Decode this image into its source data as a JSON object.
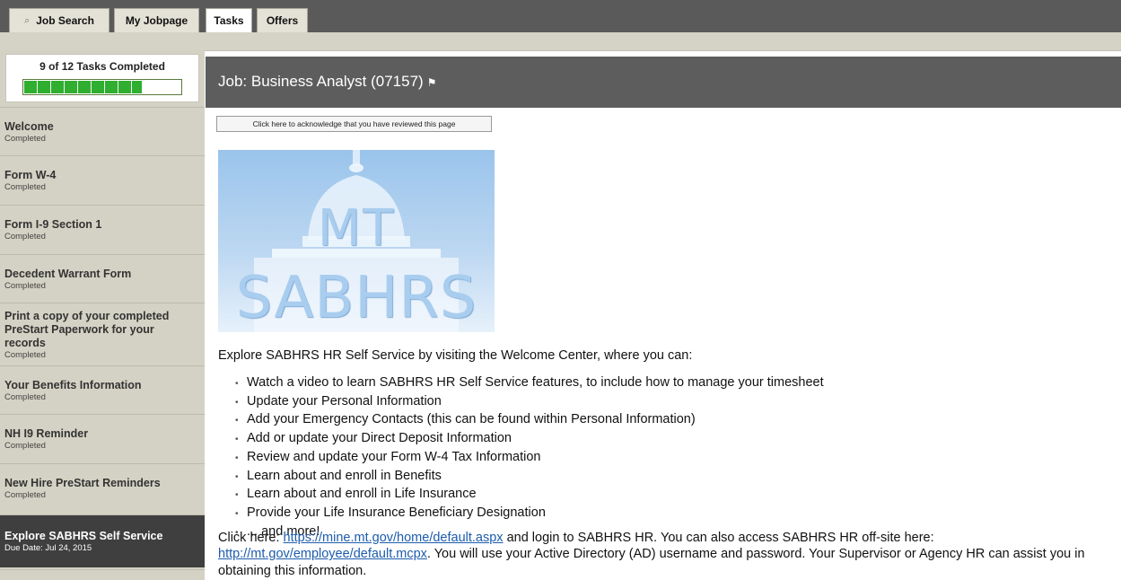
{
  "tabs": [
    {
      "label": "Job Search",
      "icon": "search-icon"
    },
    {
      "label": "My Jobpage"
    },
    {
      "label": "Tasks",
      "active": true
    },
    {
      "label": "Offers"
    }
  ],
  "progress": {
    "label": "9 of 12 Tasks Completed",
    "completed": 9,
    "total": 12,
    "color": "#2fae30"
  },
  "tasks": [
    {
      "title": "Welcome",
      "status": "Completed"
    },
    {
      "title": "Form W-4",
      "status": "Completed"
    },
    {
      "title": "Form I-9 Section 1",
      "status": "Completed"
    },
    {
      "title": "Decedent Warrant Form",
      "status": "Completed"
    },
    {
      "title": "Print a copy of your completed PreStart Paperwork for your records",
      "status": "Completed"
    },
    {
      "title": "Your Benefits Information",
      "status": "Completed"
    },
    {
      "title": "NH I9 Reminder",
      "status": "Completed"
    },
    {
      "title": "New Hire PreStart Reminders",
      "status": "Completed"
    },
    {
      "title": "Explore SABHRS Self Service",
      "status": "Due Date: Jul 24, 2015",
      "current": true
    }
  ],
  "job": {
    "title": "Job: Business Analyst (07157)",
    "flag_icon": "flag-icon"
  },
  "ack_button": "Click here to acknowledge that you have reviewed this page",
  "logo": {
    "line1": "MT",
    "line2": "SABHRS"
  },
  "intro": "Explore SABHRS HR Self Service by visiting the Welcome Center, where you can:",
  "bullets": [
    "Watch a video to learn SABHRS HR Self Service features, to include how to manage your timesheet",
    "Update your Personal Information",
    "Add your Emergency Contacts (this can be found within Personal Information)",
    "Add or update your Direct Deposit Information",
    "Review and update your Form W-4 Tax Information",
    "Learn about and enroll in Benefits",
    "Learn about and enroll in Life Insurance",
    "Provide your Life Insurance Beneficiary Designation",
    "... and more!"
  ],
  "paragraph": {
    "part1": "Click here: ",
    "link1": "https://mine.mt.gov/home/default.aspx",
    "part2": " and login to SABHRS HR. You can also access SABHRS HR off-site here: ",
    "link2": "http://mt.gov/employee/default.mcpx",
    "part3": ". You will use your Active Directory (AD) username and password. Your Supervisor or Agency HR can assist you in obtaining this information."
  },
  "colors": {
    "header_bg": "#5d5d5d",
    "sidebar_bg": "#d4d2c4",
    "current_task_bg": "#3f3f3f",
    "link": "#1d5cad"
  }
}
